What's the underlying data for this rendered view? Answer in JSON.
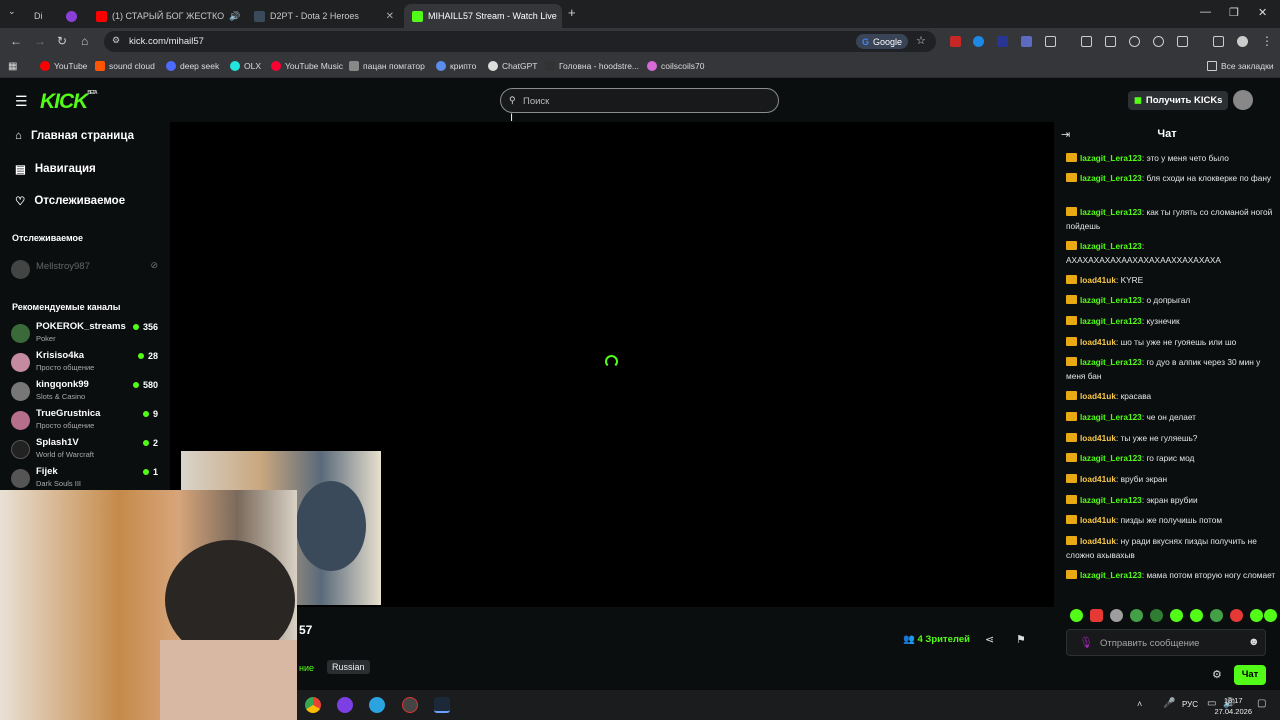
{
  "browser": {
    "tabs": [
      {
        "label": "Di",
        "color": "#5865f2"
      },
      {
        "label": "(1) СТАРЫЙ БОГ ЖЕСТКО",
        "color": "#ff0000"
      },
      {
        "label": "D2PT - Dota 2 Heroes",
        "color": "#3a4a5a"
      },
      {
        "label": "MIHAILL57 Stream - Watch Live",
        "color": "#53fc18"
      }
    ],
    "url": "kick.com/mihail57",
    "google_chip": "Google",
    "bookmarks": [
      "YouTube",
      "sound cloud",
      "deep seek",
      "OLX",
      "YouTube Music",
      "пацан помгатор",
      "крипто",
      "ChatGPT",
      "Головна - hoodstre...",
      "coilscoils70"
    ],
    "all_bookmarks": "Все закладки"
  },
  "kick": {
    "logo": "KICK",
    "logo_sup": "BETA",
    "search_placeholder": "Поиск",
    "get_kicks": "Получить KICKs",
    "nav": [
      "Главная страница",
      "Навигация",
      "Отслеживаемое"
    ],
    "followed_heading": "Отслеживаемое",
    "followed_channel": "Mellstroy987",
    "recommended_heading": "Рекомендуемые каналы",
    "channels": [
      {
        "name": "POKEROK_streams",
        "category": "Poker",
        "viewers": "356",
        "color": "#3a6a3a"
      },
      {
        "name": "Krisiso4ka",
        "category": "Просто общение",
        "viewers": "28",
        "color": "#c48aa0"
      },
      {
        "name": "kingqonk99",
        "category": "Slots & Casino",
        "viewers": "580",
        "color": "#777"
      },
      {
        "name": "TrueGrustnica",
        "category": "Просто общение",
        "viewers": "9",
        "color": "#b56f8a"
      },
      {
        "name": "Splash1V",
        "category": "World of Warcraft",
        "viewers": "2",
        "color": "#222"
      },
      {
        "name": "Fijek",
        "category": "Dark Souls III",
        "viewers": "1",
        "color": "#555"
      }
    ],
    "stream": {
      "viewers": "4 Зрителей",
      "language": "Russian",
      "title_fragment": "57",
      "category_fragment": "ние"
    },
    "chat": {
      "title": "Чат",
      "input_placeholder": "Отправить сообщение",
      "button": "Чат",
      "messages": [
        {
          "user": "lazagit_Lera123",
          "text": "это у меня чето было"
        },
        {
          "user": "lazagit_Lera123",
          "text": "бля сходи на клокверке по фану"
        },
        {
          "user": "lazagit_Lera123",
          "text": "как ты гулять со сломаной ногой пойдешь"
        },
        {
          "user": "lazagit_Lera123",
          "text": "АХАХАХАХАХААХАХАХААХХАХАХАХА"
        },
        {
          "user": "load41uk",
          "text": "KYRE"
        },
        {
          "user": "lazagit_Lera123",
          "text": "о допрыгал"
        },
        {
          "user": "lazagit_Lera123",
          "text": "кузнечик"
        },
        {
          "user": "load41uk",
          "text": "шо ты уже не гуояешь или шо"
        },
        {
          "user": "lazagit_Lera123",
          "text": "го дуо в алпик через 30 мин у меня бан"
        },
        {
          "user": "load41uk",
          "text": "красава"
        },
        {
          "user": "lazagit_Lera123",
          "text": "че он делает"
        },
        {
          "user": "load41uk",
          "text": "ты уже не гуляешь?"
        },
        {
          "user": "lazagit_Lera123",
          "text": "го гарис мод"
        },
        {
          "user": "load41uk",
          "text": "вруби экран"
        },
        {
          "user": "lazagit_Lera123",
          "text": "экран врубии"
        },
        {
          "user": "load41uk",
          "text": "пизды же получишь потом"
        },
        {
          "user": "load41uk",
          "text": "ну ради вкуснях пизды получить не сложно ахывахыв"
        },
        {
          "user": "lazagit_Lera123",
          "text": "мама потом вторую ногу сломает"
        }
      ]
    }
  },
  "taskbar": {
    "lang": "РУС",
    "time": "18:17",
    "date": "27.04.2026"
  },
  "colors": {
    "accent": "#53fc18",
    "user_green": "#53fc18",
    "user_yellow": "#f7c948"
  }
}
